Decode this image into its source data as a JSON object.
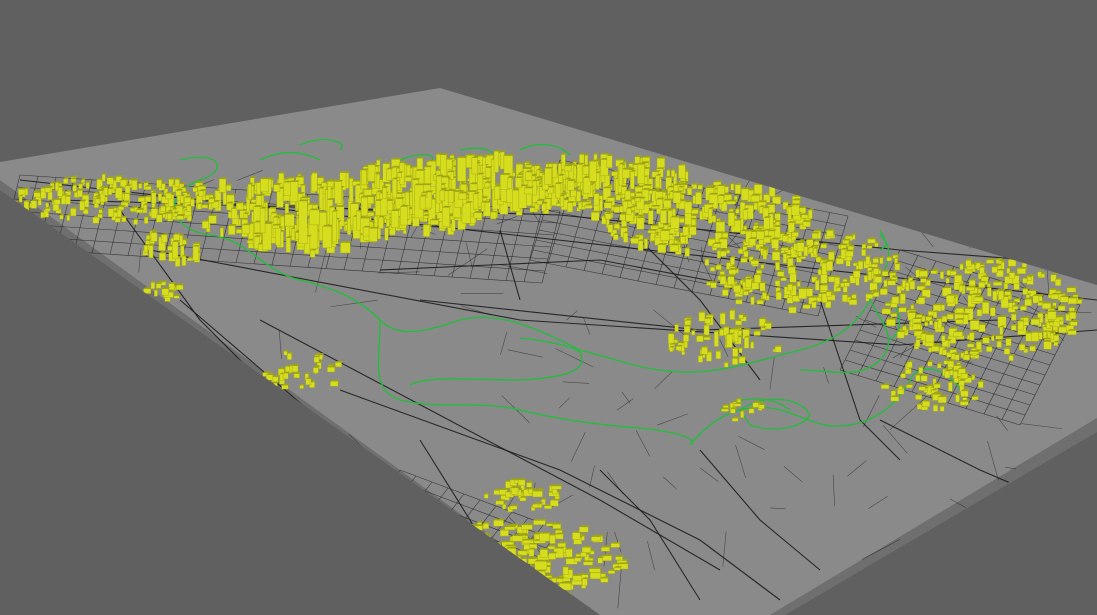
{
  "viewport": {
    "background_color": "#606060"
  },
  "scene": {
    "kind": "3d-city-model",
    "colors": {
      "ground_top": "#8a8a8a",
      "ground_side": "#6f6f6f",
      "ground_side_dark": "#5e5e5e",
      "buildings": "#d6dc1e",
      "buildings_shade": "#9ea514",
      "roads": "#1c1c1c",
      "water_lines": "#1fbf3a"
    },
    "layers": [
      "ground-plane",
      "road-network",
      "river-outline",
      "building-blocks"
    ]
  }
}
